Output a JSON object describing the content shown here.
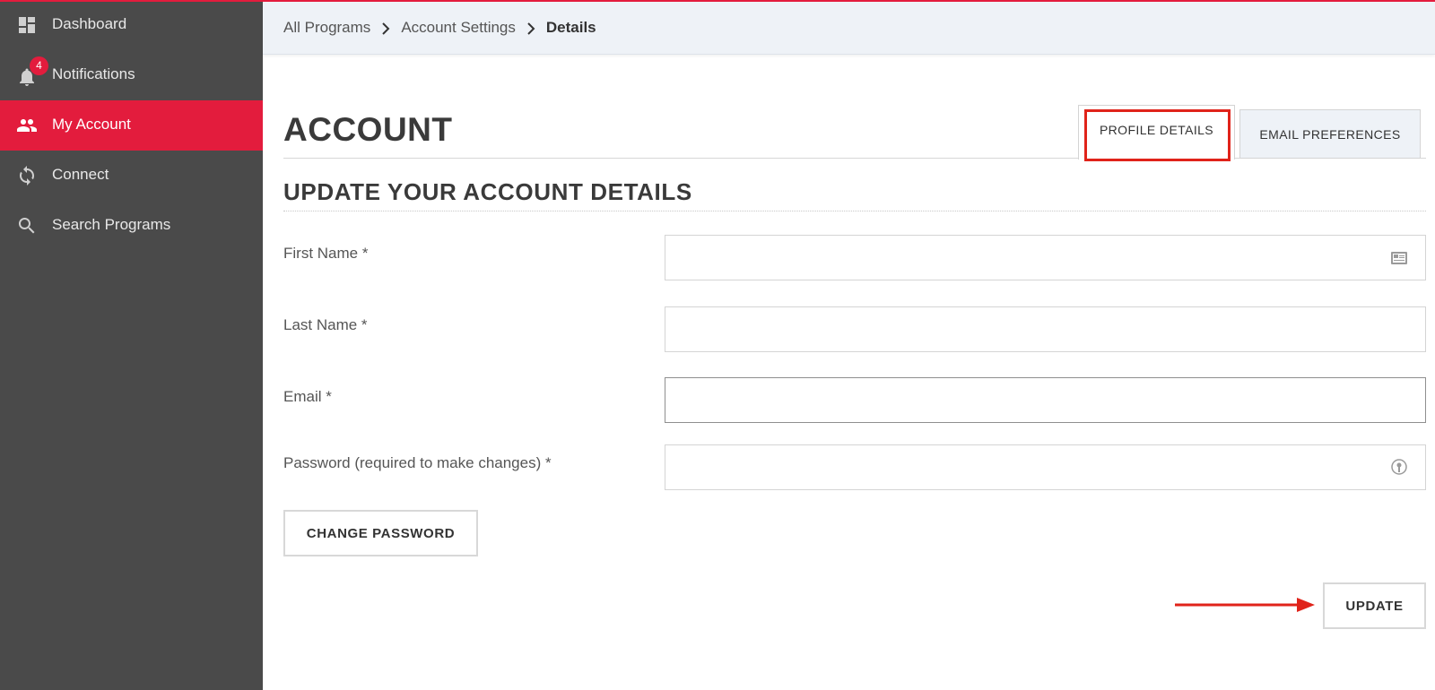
{
  "sidebar": {
    "items": [
      {
        "label": "Dashboard",
        "icon": "dashboard-icon"
      },
      {
        "label": "Notifications",
        "icon": "bell-icon",
        "badge": "4"
      },
      {
        "label": "My Account",
        "icon": "people-icon",
        "active": true
      },
      {
        "label": "Connect",
        "icon": "sync-icon"
      },
      {
        "label": "Search Programs",
        "icon": "search-icon"
      }
    ]
  },
  "breadcrumb": {
    "items": [
      "All Programs",
      "Account Settings"
    ],
    "current": "Details"
  },
  "page": {
    "title": "ACCOUNT",
    "section_title": "UPDATE YOUR ACCOUNT DETAILS"
  },
  "tabs": {
    "profile": "PROFILE DETAILS",
    "email": "EMAIL PREFERENCES",
    "active": "PROFILE DETAILS"
  },
  "form": {
    "first_name": {
      "label": "First Name *",
      "value": ""
    },
    "last_name": {
      "label": "Last Name *",
      "value": ""
    },
    "email": {
      "label": "Email *",
      "value": ""
    },
    "password": {
      "label": "Password (required to make changes) *",
      "value": ""
    }
  },
  "buttons": {
    "change_password": "CHANGE PASSWORD",
    "update": "UPDATE"
  },
  "colors": {
    "accent": "#e31c3d",
    "sidebar_bg": "#4a4a4a",
    "header_bg": "#eef2f7",
    "highlight_annotation": "#e0231a"
  }
}
